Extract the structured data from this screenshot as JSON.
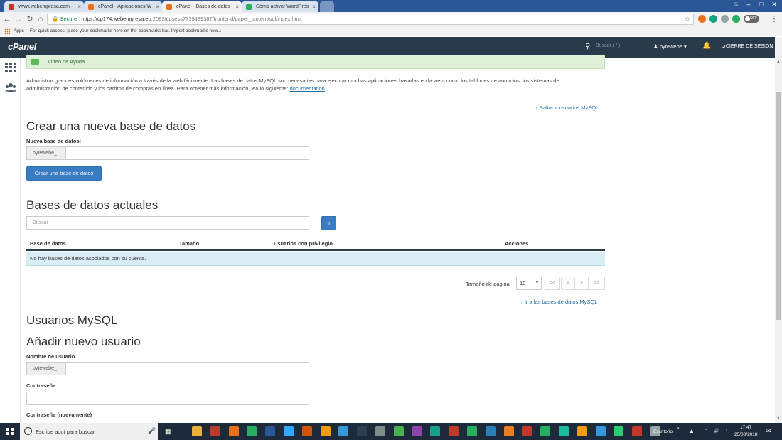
{
  "browser": {
    "tabs": [
      {
        "title": "www.webempresa.com -",
        "favicon_color": "#c0392b"
      },
      {
        "title": "cPanel - Aplicaciones W",
        "favicon_color": "#e8711a"
      },
      {
        "title": "cPanel - Bases de datos",
        "favicon_color": "#e8711a"
      },
      {
        "title": "Cómo activar WordPres",
        "favicon_color": "#27ae60"
      }
    ],
    "close_glyph": "×",
    "url": {
      "secure_label": "Secure",
      "host": "https://cp174.webempresa.eu",
      "path": ":2083/cpsess7735489387/frontend/paper_lantern/sql/index.html"
    },
    "toggle_label": "OFF",
    "bookmarks": {
      "apps_label": "Apps",
      "message": "For quick access, place your bookmarks here on the bookmarks bar.",
      "import_link": "Import bookmarks now..."
    }
  },
  "cpanel": {
    "logo": "cPanel",
    "search_placeholder": "Buscar ( / )",
    "username": "bytewebe",
    "logout_label": "CIERRE DE SESIÓN"
  },
  "main": {
    "help_video": "Video de Ayuda",
    "intro": "Administrar grandes volúmenes de información a través de la web fácilmente. Las bases de datos MySQL son necesarias para ejecutar muchas aplicaciones basadas en la web, como los tablones de anuncios, los sistemas de administración de contenido y los carritos de compras en línea. Para obtener más información, lea lo siguiente:",
    "doc_link": "documentation",
    "jump_users": "Saltar a usuarios MySQL",
    "create_db": {
      "heading": "Crear una nueva base de datos",
      "label": "Nueva base de datos:",
      "prefix": "bytewebe_",
      "button": "Crear una base de datos"
    },
    "current_dbs": {
      "heading": "Bases de datos actuales",
      "search_placeholder": "Buscar",
      "go_button": "Ir",
      "columns": [
        "Base de datos",
        "Tamaño",
        "Usuarios con privilegio",
        "Acciones"
      ],
      "empty_message": "No hay bases de datos asociados con su cuenta.",
      "page_size_label": "Tamaño de página",
      "page_size": "10",
      "pager": [
        "<<",
        "<",
        ">",
        ">>"
      ],
      "jump_dbs": "Ir a las bases de datos MySQL"
    },
    "mysql_users": {
      "heading": "Usuarios MySQL",
      "subheading": "Añadir nuevo usuario",
      "username_label": "Nombre de usuario",
      "prefix": "bytewebe_",
      "password_label": "Contraseña",
      "password_again_label": "Contraseña (nuevamente)"
    }
  },
  "taskbar": {
    "search_text": "Escribe aquí para buscar",
    "desktop_label": "Escritorio",
    "time": "17:47",
    "date": "25/08/2018",
    "app_colors": [
      "#e8b13a",
      "#c0392b",
      "#e8711a",
      "#27ae60",
      "#2b5797",
      "#31a8ff",
      "#d35400",
      "#f39c12",
      "#3498db",
      "#2c3e50",
      "#7f8c8d",
      "#4caf50",
      "#8e44ad",
      "#16a085",
      "#c0392b",
      "#27ae60",
      "#2980b9",
      "#e67e22",
      "#c0392b",
      "#27ae60",
      "#1abc9c",
      "#f39c12",
      "#3498db",
      "#2ecc71",
      "#c0392b",
      "#95a5a6"
    ]
  }
}
